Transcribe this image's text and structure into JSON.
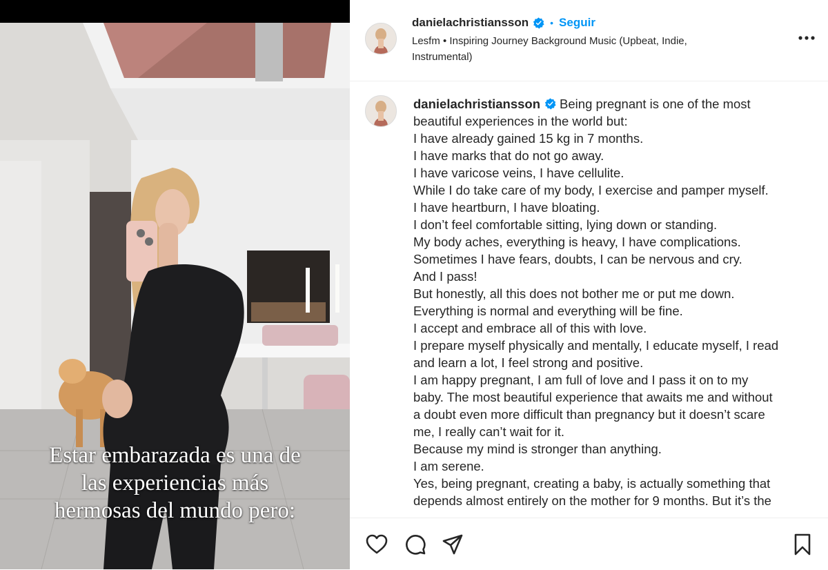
{
  "media": {
    "overlay_lines": [
      "Estar embarazada es una de",
      "las experiencias más",
      "hermosas del mundo pero:"
    ]
  },
  "header": {
    "username": "danielachristiansson",
    "verified_icon": "verified-badge-icon",
    "separator": "•",
    "follow_label": "Seguir",
    "audio": "Lesfm • Inspiring Journey Background Music (Upbeat, Indie, Instrumental)",
    "more_icon": "more-options-icon"
  },
  "caption": {
    "username": "danielachristiansson",
    "lines": [
      "Being pregnant is one of the most",
      "beautiful experiences in the world but:",
      "I have already gained 15 kg in 7 months.",
      "I have marks that do not go away.",
      "I have varicose veins, I have cellulite.",
      "While I do take care of my body, I exercise and pamper myself.",
      "I have heartburn, I have bloating.",
      "I don’t feel comfortable sitting, lying down or standing.",
      "My body aches, everything is heavy, I have complications.",
      "Sometimes I have fears, doubts, I can be nervous and cry.",
      "And I pass!",
      "But honestly, all this does not bother me or put me down.",
      "Everything is normal and everything will be fine.",
      "I accept and embrace all of this with love.",
      "I prepare myself physically and mentally, I educate myself, I read",
      "and learn a lot, I feel strong and positive.",
      "I am happy pregnant, I am full of love and I pass it on to my",
      "baby. The most beautiful experience that awaits me and without",
      "a doubt even more difficult than pregnancy but it doesn’t scare",
      "me, I really can’t wait for it.",
      "Because my mind is stronger than anything.",
      "I am serene.",
      "Yes, being pregnant, creating a baby, is actually something that",
      "depends almost entirely on the mother for 9 months. But it’s the"
    ]
  },
  "actions": {
    "like_icon": "heart-icon",
    "comment_icon": "comment-bubble-icon",
    "share_icon": "paper-plane-icon",
    "save_icon": "bookmark-icon"
  },
  "colors": {
    "accent": "#0095f6",
    "text": "#262626",
    "divider": "#efefef"
  }
}
